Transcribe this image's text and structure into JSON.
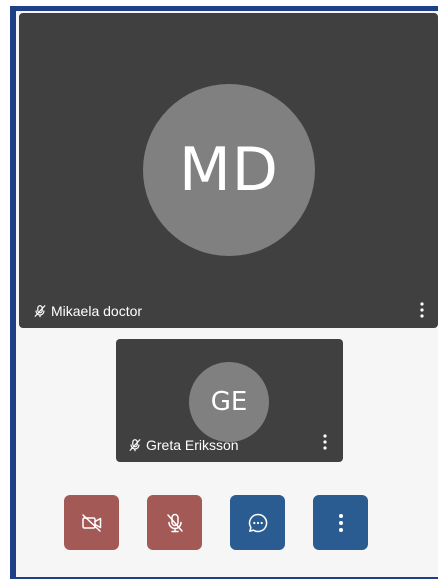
{
  "participants": {
    "main": {
      "initials": "MD",
      "name": "Mikaela doctor",
      "muted": true
    },
    "secondary": {
      "initials": "GE",
      "name": "Greta Eriksson",
      "muted": true
    }
  },
  "controls": {
    "camera": {
      "icon": "camera-off-icon",
      "state": "off"
    },
    "microphone": {
      "icon": "mic-off-icon",
      "state": "off"
    },
    "chat": {
      "icon": "chat-bubble-icon"
    },
    "more": {
      "icon": "more-vertical-icon"
    }
  },
  "colors": {
    "tile_background": "#404040",
    "avatar_background": "#808080",
    "button_off": "#a35a57",
    "button_on": "#2a5c91",
    "frame_border": "#1f3f86"
  }
}
